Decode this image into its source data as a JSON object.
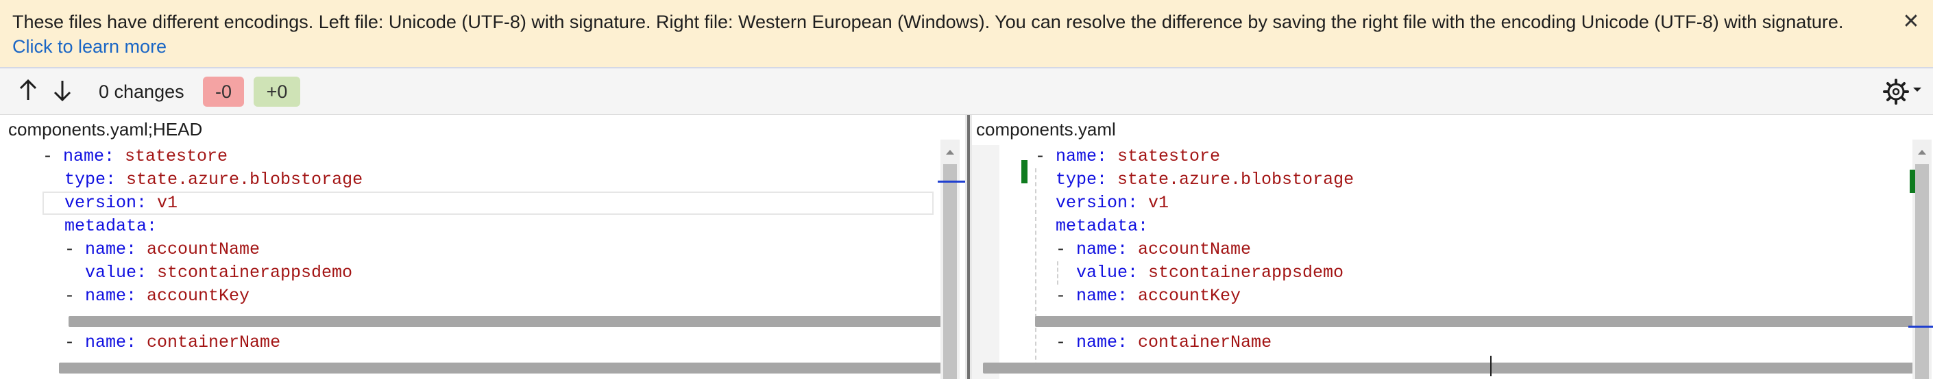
{
  "infobar": {
    "message": "These files have different encodings. Left file: Unicode (UTF-8) with signature. Right file: Western European (Windows). You can resolve the difference by saving the right file with the encoding Unicode (UTF-8) with signature.",
    "link_text": "Click to learn more",
    "close_icon": "close-icon"
  },
  "toolbar": {
    "prev_icon": "arrow-up-icon",
    "next_icon": "arrow-down-icon",
    "changes_label": "0 changes",
    "deletions_badge": "-0",
    "additions_badge": "+0",
    "settings_icon": "gear-icon"
  },
  "left": {
    "title": "components.yaml;HEAD",
    "lines": [
      {
        "dash": "- ",
        "key": "name:",
        "val": " statestore"
      },
      {
        "dash": "",
        "key": "type:",
        "val": " state.azure.blobstorage"
      },
      {
        "dash": "",
        "key": "version:",
        "val": " v1"
      },
      {
        "dash": "",
        "key": "metadata:",
        "val": ""
      },
      {
        "dash": "- ",
        "key": "name:",
        "val": " accountName"
      },
      {
        "dash": "",
        "key": "value:",
        "val": " stcontainerappsdemo"
      },
      {
        "dash": "- ",
        "key": "name:",
        "val": " accountKey"
      },
      {
        "dash": "- ",
        "key": "name:",
        "val": " containerName"
      }
    ]
  },
  "right": {
    "title": "components.yaml",
    "lines": [
      {
        "dash": "- ",
        "key": "name:",
        "val": " statestore"
      },
      {
        "dash": "",
        "key": "type:",
        "val": " state.azure.blobstorage"
      },
      {
        "dash": "",
        "key": "version:",
        "val": " v1"
      },
      {
        "dash": "",
        "key": "metadata:",
        "val": ""
      },
      {
        "dash": "- ",
        "key": "name:",
        "val": " accountName"
      },
      {
        "dash": "",
        "key": "value:",
        "val": " stcontainerappsdemo"
      },
      {
        "dash": "- ",
        "key": "name:",
        "val": " accountKey"
      },
      {
        "dash": "- ",
        "key": "name:",
        "val": " containerName"
      }
    ]
  },
  "colors": {
    "infobar_bg": "#fdf0d2",
    "link": "#1a66c5",
    "yaml_key": "#1010e0",
    "yaml_value": "#a31515",
    "deletions_badge_bg": "#f4a3a3",
    "additions_badge_bg": "#cfe3b6",
    "change_marker": "#0f7b1f"
  }
}
